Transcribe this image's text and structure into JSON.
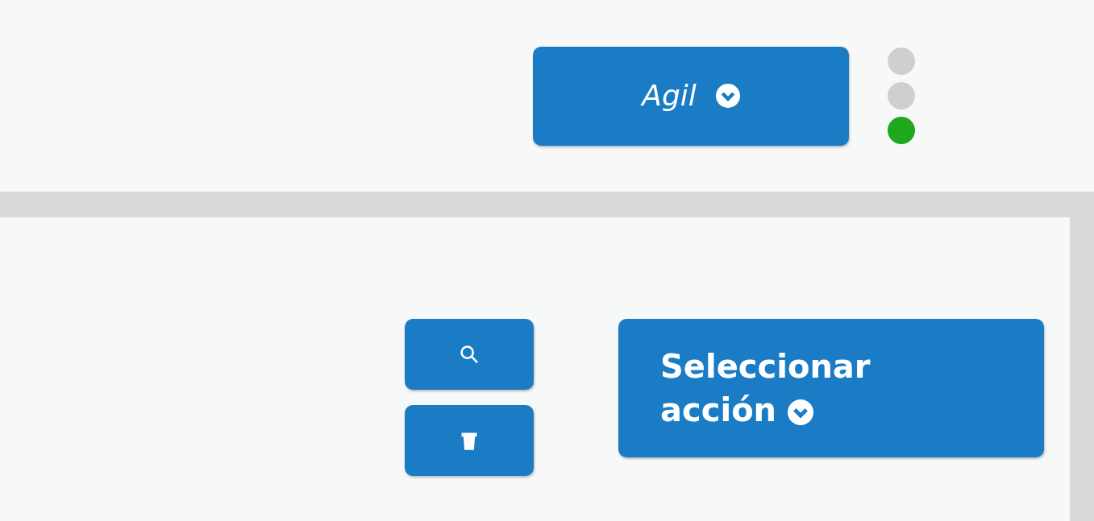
{
  "mode_button": {
    "label": "Agil"
  },
  "status_lights": [
    {
      "on": false
    },
    {
      "on": false
    },
    {
      "on": true
    }
  ],
  "tool_buttons": [
    {
      "kind": "search"
    },
    {
      "kind": "delete"
    }
  ],
  "action_button": {
    "label": "Seleccionar acción"
  }
}
